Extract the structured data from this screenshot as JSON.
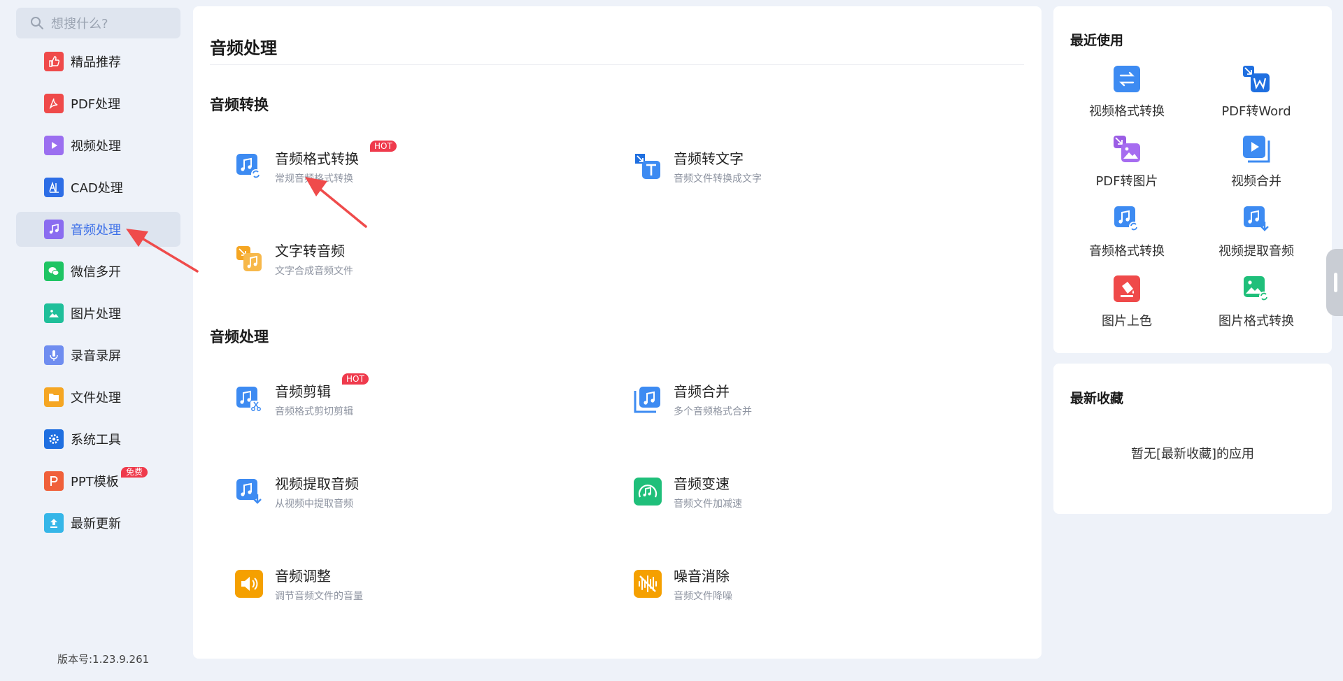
{
  "search": {
    "placeholder": "想搜什么?"
  },
  "sidebar": {
    "items": [
      {
        "label": "精品推荐",
        "icon": "thumbs-up-icon",
        "color": "#ef4a4a"
      },
      {
        "label": "PDF处理",
        "icon": "pdf-icon",
        "color": "#ef4a4a"
      },
      {
        "label": "视频处理",
        "icon": "play-icon",
        "color": "#9b6ff0"
      },
      {
        "label": "CAD处理",
        "icon": "cad-icon",
        "color": "#2d6ee6"
      },
      {
        "label": "音频处理",
        "icon": "music-note-icon",
        "color": "#8a6cf0",
        "active": true
      },
      {
        "label": "微信多开",
        "icon": "wechat-icon",
        "color": "#1ec463"
      },
      {
        "label": "图片处理",
        "icon": "image-icon",
        "color": "#1fbf9a"
      },
      {
        "label": "录音录屏",
        "icon": "microphone-icon",
        "color": "#6f8df0"
      },
      {
        "label": "文件处理",
        "icon": "folder-icon",
        "color": "#f5a623"
      },
      {
        "label": "系统工具",
        "icon": "gear-icon",
        "color": "#1f6fe0"
      },
      {
        "label": "PPT模板",
        "icon": "ppt-icon",
        "color": "#f0603a",
        "badge": "免费"
      },
      {
        "label": "最新更新",
        "icon": "upload-icon",
        "color": "#35b6e8"
      }
    ],
    "version": "版本号:1.23.9.261"
  },
  "main": {
    "title": "音频处理",
    "sections": [
      {
        "title": "音频转换",
        "tools": [
          {
            "name": "音频格式转换",
            "desc": "常规音频格式转换",
            "hot": "HOT",
            "icon": "audio-convert-icon"
          },
          {
            "name": "音频转文字",
            "desc": "音频文件转换成文字",
            "icon": "audio-to-text-icon"
          },
          {
            "name": "文字转音频",
            "desc": "文字合成音频文件",
            "icon": "text-to-audio-icon"
          }
        ]
      },
      {
        "title": "音频处理",
        "tools": [
          {
            "name": "音频剪辑",
            "desc": "音频格式剪切剪辑",
            "hot": "HOT",
            "icon": "audio-cut-icon"
          },
          {
            "name": "音频合并",
            "desc": "多个音频格式合并",
            "icon": "audio-merge-icon"
          },
          {
            "name": "视频提取音频",
            "desc": "从视频中提取音频",
            "icon": "extract-audio-icon"
          },
          {
            "name": "音频变速",
            "desc": "音频文件加减速",
            "icon": "audio-speed-icon"
          },
          {
            "name": "音频调整",
            "desc": "调节音频文件的音量",
            "icon": "volume-icon"
          },
          {
            "name": "噪音消除",
            "desc": "音频文件降噪",
            "icon": "denoise-icon"
          }
        ]
      }
    ]
  },
  "recent": {
    "title": "最近使用",
    "items": [
      {
        "label": "视频格式转换",
        "icon": "swap-icon"
      },
      {
        "label": "PDF转Word",
        "icon": "pdf-to-word-icon"
      },
      {
        "label": "PDF转图片",
        "icon": "pdf-to-image-icon"
      },
      {
        "label": "视频合并",
        "icon": "video-merge-icon"
      },
      {
        "label": "音频格式转换",
        "icon": "audio-convert-icon"
      },
      {
        "label": "视频提取音频",
        "icon": "extract-audio-icon"
      },
      {
        "label": "图片上色",
        "icon": "paint-bucket-icon"
      },
      {
        "label": "图片格式转换",
        "icon": "image-convert-icon"
      }
    ]
  },
  "favorites": {
    "title": "最新收藏",
    "empty_text": "暂无[最新收藏]的应用"
  },
  "colors": {
    "accent": "#3a6ee8",
    "hot_badge": "#ef3a4c",
    "annotation_arrow": "#ef4b4b"
  }
}
